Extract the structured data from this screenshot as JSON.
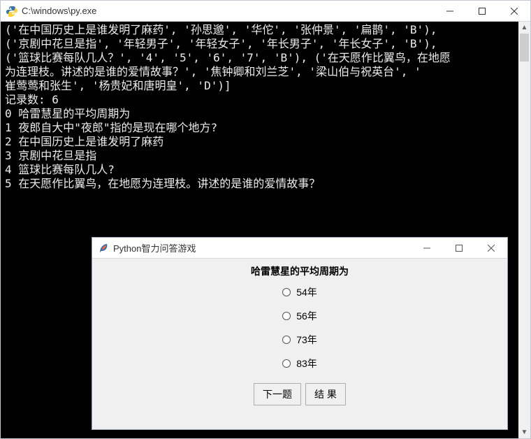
{
  "console": {
    "title": "C:\\windows\\py.exe",
    "lines": [
      "('在中国历史上是谁发明了麻药', '孙思邈', '华佗', '张仲景', '扁鹊', 'B'),",
      "('京剧中花旦是指', '年轻男子', '年轻女子', '年长男子', '年长女子', 'B'),",
      "('篮球比赛每队几人？', '4', '5', '6', '7', 'B'), ('在天愿作比翼鸟，在地愿",
      "为连理枝。讲述的是谁的爱情故事？', '焦钟卿和刘兰芝', '梁山伯与祝英台', '",
      "崔莺莺和张生', '杨贵妃和唐明皇', 'D')]",
      "记录数: 6",
      "0 哈雷慧星的平均周期为",
      "1 夜郎自大中\"夜郎\"指的是现在哪个地方?",
      "2 在中国历史上是谁发明了麻药",
      "3 京剧中花旦是指",
      "4 篮球比赛每队几人?",
      "5 在天愿作比翼鸟，在地愿为连理枝。讲述的是谁的爱情故事？"
    ]
  },
  "dialog": {
    "title": "Python智力问答游戏",
    "question": "哈雷慧星的平均周期为",
    "options": [
      "54年",
      "56年",
      "73年",
      "83年"
    ],
    "buttons": {
      "next": "下一题",
      "result": "结 果"
    }
  }
}
